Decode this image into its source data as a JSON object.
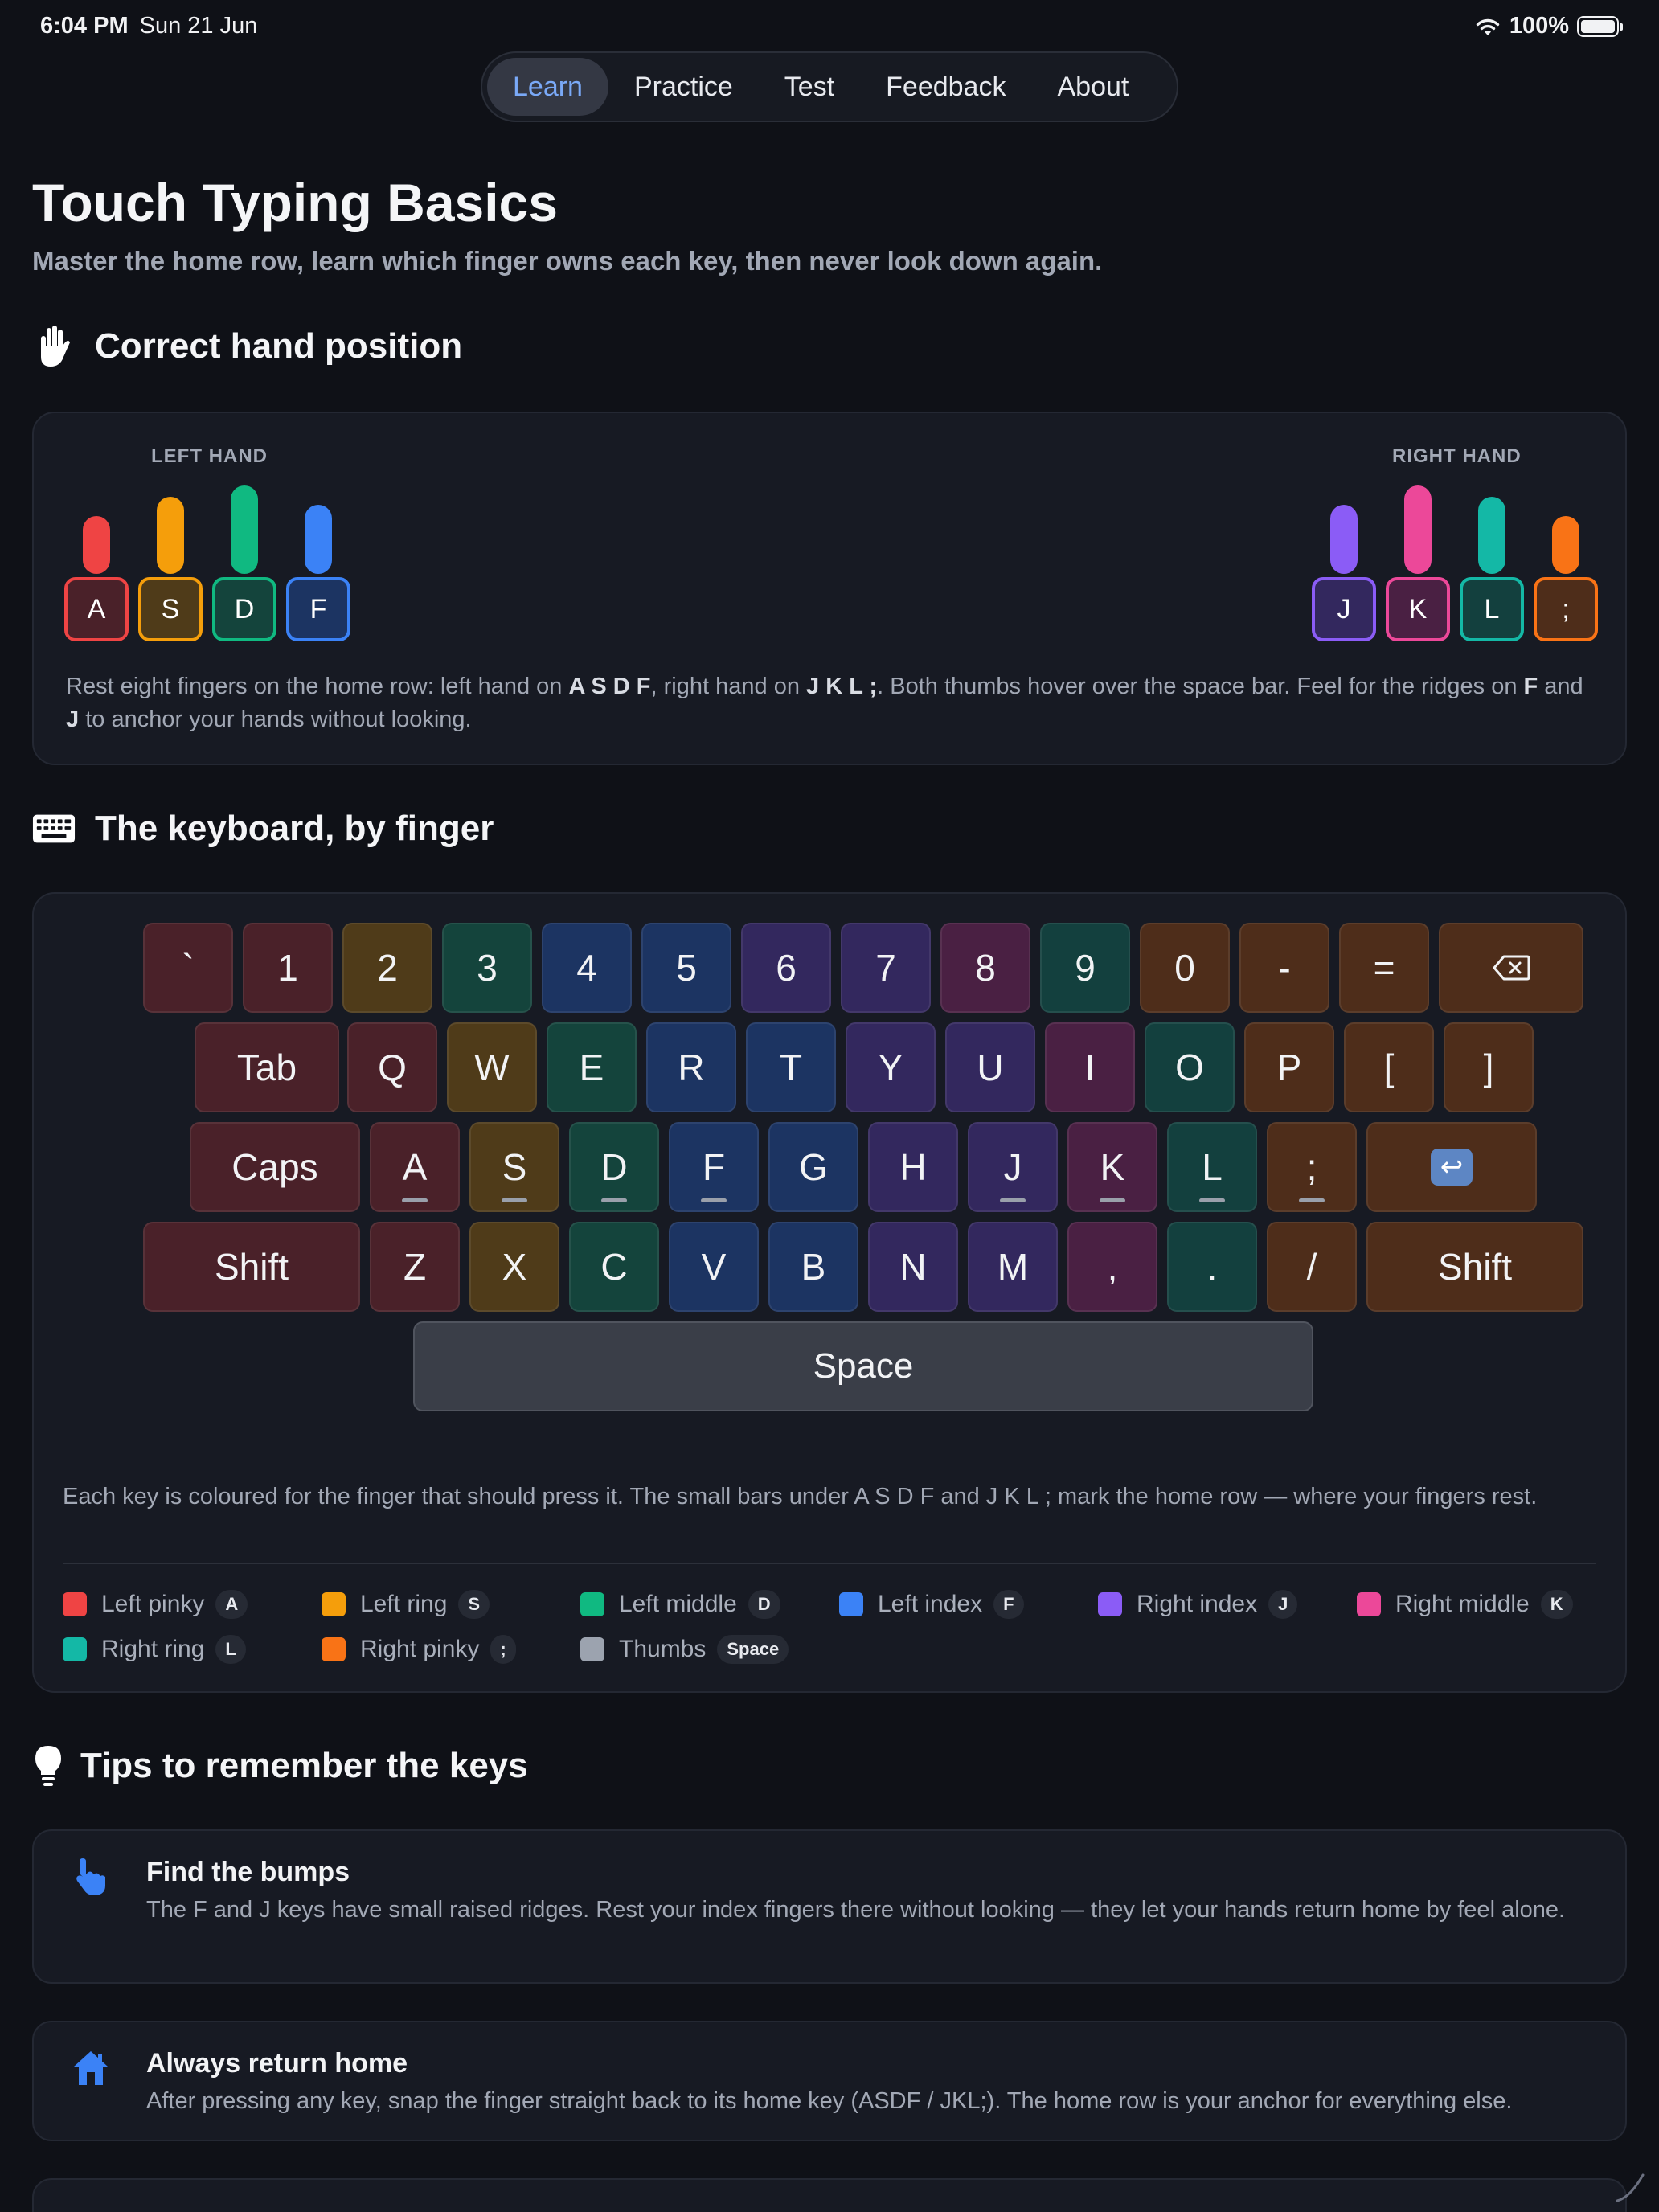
{
  "status": {
    "time": "6:04 PM",
    "date": "Sun 21 Jun",
    "battery": "100%"
  },
  "nav": {
    "tabs": [
      {
        "label": "Learn",
        "active": true
      },
      {
        "label": "Practice"
      },
      {
        "label": "Test"
      },
      {
        "label": "Feedback"
      },
      {
        "label": "About"
      }
    ]
  },
  "page": {
    "title": "Touch Typing Basics",
    "subtitle": "Master the home row, learn which finger owns each key, then never look down again."
  },
  "hands": {
    "title": "Correct hand position",
    "left_label": "LEFT HAND",
    "right_label": "RIGHT HAND",
    "left_keys": [
      "A",
      "S",
      "D",
      "F"
    ],
    "right_keys": [
      "J",
      "K",
      "L",
      ";"
    ],
    "text_parts": [
      "Rest eight fingers on the home row: left hand on ",
      "A S D F",
      ", right hand on ",
      "J K L ;",
      ". Both thumbs hover over the space bar. Feel for the ridges on ",
      "F",
      " and ",
      "J",
      " to anchor your hands without looking."
    ]
  },
  "keyboard": {
    "title": "The keyboard, by finger",
    "rows": [
      [
        "`",
        "1",
        "2",
        "3",
        "4",
        "5",
        "6",
        "7",
        "8",
        "9",
        "0",
        "-",
        "="
      ],
      [
        "Tab",
        "Q",
        "W",
        "E",
        "R",
        "T",
        "Y",
        "U",
        "I",
        "O",
        "P",
        "[",
        "]"
      ],
      [
        "Caps",
        "A",
        "S",
        "D",
        "F",
        "G",
        "H",
        "J",
        "K",
        "L",
        ";"
      ],
      [
        "Shift",
        "Z",
        "X",
        "C",
        "V",
        "B",
        "N",
        "M",
        ",",
        ".",
        "/",
        "Shift"
      ]
    ],
    "space_label": "Space",
    "enter_label": "↩",
    "description": "Each key is coloured for the finger that should press it. The small bars under A S D F and J K L ; mark the home row — where your fingers rest.",
    "legend": [
      {
        "label": "Left pinky",
        "key": "A",
        "color": "#ef4444"
      },
      {
        "label": "Left ring",
        "key": "S",
        "color": "#f59e0b"
      },
      {
        "label": "Left middle",
        "key": "D",
        "color": "#10b981"
      },
      {
        "label": "Left index",
        "key": "F",
        "color": "#3b82f6"
      },
      {
        "label": "Right index",
        "key": "J",
        "color": "#8b5cf6"
      },
      {
        "label": "Right middle",
        "key": "K",
        "color": "#ec4899"
      },
      {
        "label": "Right ring",
        "key": "L",
        "color": "#14b8a6"
      },
      {
        "label": "Right pinky",
        "key": ";",
        "color": "#f97316"
      },
      {
        "label": "Thumbs",
        "key": "Space",
        "color": "#9ca3af"
      }
    ]
  },
  "tips": {
    "title": "Tips to remember the keys",
    "items": [
      {
        "icon": "pointing-hand-icon",
        "title": "Find the bumps",
        "body": "The F and J keys have small raised ridges. Rest your index fingers there without looking — they let your hands return home by feel alone."
      },
      {
        "icon": "home-icon",
        "title": "Always return home",
        "body": "After pressing any key, snap the finger straight back to its home key (ASDF / JKL;). The home row is your anchor for everything else."
      }
    ]
  }
}
